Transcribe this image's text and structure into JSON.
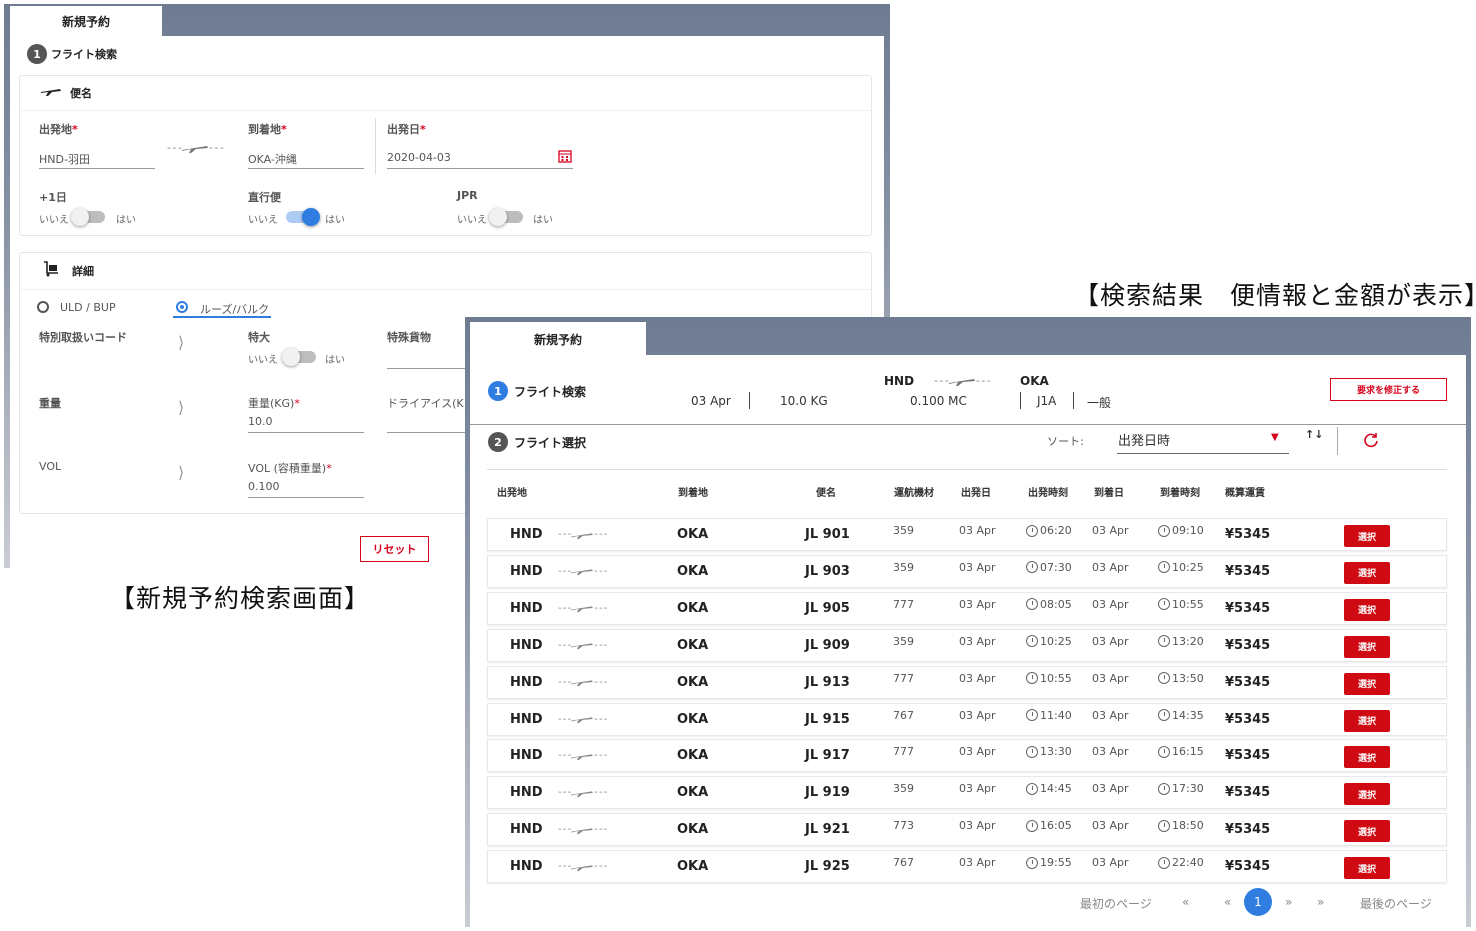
{
  "screen1": {
    "tab_title": "新規予約",
    "step1": {
      "num": "1",
      "label": "フライト検索"
    },
    "flight_section": {
      "title": "便名",
      "origin_label": "出発地",
      "origin_value": "HND-羽田",
      "dest_label": "到着地",
      "dest_value": "OKA-沖縄",
      "date_label": "出発日",
      "date_value": "2020-04-03",
      "plus1_label": "+1日",
      "direct_label": "直行便",
      "jpr_label": "JPR",
      "no": "いいえ",
      "yes": "はい",
      "plus1_on": false,
      "direct_on": true,
      "jpr_on": false
    },
    "detail_section": {
      "title": "詳細",
      "radio_uld": "ULD / BUP",
      "radio_loose": "ルーズ/バルク",
      "special_code_label": "特別取扱いコード",
      "oversize_label": "特大",
      "special_cargo_label": "特殊貨物",
      "weight_row_label": "重量",
      "weight_label": "重量(KG)",
      "weight_value": "10.0",
      "dryice_label": "ドライアイス(K",
      "vol_row_label": "VOL",
      "vol_label": "VOL (容積重量)",
      "vol_value": "0.100",
      "no": "いいえ",
      "yes": "はい",
      "oversize_on": false
    },
    "reset_button": "リセット",
    "caption": "【新規予約検索画面】"
  },
  "screen2": {
    "caption": "【検索結果　便情報と金額が表示】",
    "tab_title": "新規予約",
    "step1": {
      "num": "1",
      "label": "フライト検索"
    },
    "summary": {
      "date": "03 Apr",
      "weight": "10.0 KG",
      "origin": "HND",
      "dest": "OKA",
      "volume": "0.100 MC",
      "code": "J1A",
      "type": "一般"
    },
    "modify_button": "要求を修正する",
    "step2": {
      "num": "2",
      "label": "フライト選択"
    },
    "sort_label": "ソート:",
    "sort_value": "出発日時",
    "columns": [
      "出発地",
      "到着地",
      "便名",
      "運航機材",
      "出発日",
      "出発時刻",
      "到着日",
      "到着時刻",
      "概算運賃"
    ],
    "select_label": "選択",
    "rows": [
      {
        "from": "HND",
        "to": "OKA",
        "flight": "JL 901",
        "aircraft": "359",
        "dep_date": "03 Apr",
        "dep_time": "06:20",
        "arr_date": "03 Apr",
        "arr_time": "09:10",
        "fare": "¥5345"
      },
      {
        "from": "HND",
        "to": "OKA",
        "flight": "JL 903",
        "aircraft": "359",
        "dep_date": "03 Apr",
        "dep_time": "07:30",
        "arr_date": "03 Apr",
        "arr_time": "10:25",
        "fare": "¥5345"
      },
      {
        "from": "HND",
        "to": "OKA",
        "flight": "JL 905",
        "aircraft": "777",
        "dep_date": "03 Apr",
        "dep_time": "08:05",
        "arr_date": "03 Apr",
        "arr_time": "10:55",
        "fare": "¥5345"
      },
      {
        "from": "HND",
        "to": "OKA",
        "flight": "JL 909",
        "aircraft": "359",
        "dep_date": "03 Apr",
        "dep_time": "10:25",
        "arr_date": "03 Apr",
        "arr_time": "13:20",
        "fare": "¥5345"
      },
      {
        "from": "HND",
        "to": "OKA",
        "flight": "JL 913",
        "aircraft": "777",
        "dep_date": "03 Apr",
        "dep_time": "10:55",
        "arr_date": "03 Apr",
        "arr_time": "13:50",
        "fare": "¥5345"
      },
      {
        "from": "HND",
        "to": "OKA",
        "flight": "JL 915",
        "aircraft": "767",
        "dep_date": "03 Apr",
        "dep_time": "11:40",
        "arr_date": "03 Apr",
        "arr_time": "14:35",
        "fare": "¥5345"
      },
      {
        "from": "HND",
        "to": "OKA",
        "flight": "JL 917",
        "aircraft": "777",
        "dep_date": "03 Apr",
        "dep_time": "13:30",
        "arr_date": "03 Apr",
        "arr_time": "16:15",
        "fare": "¥5345"
      },
      {
        "from": "HND",
        "to": "OKA",
        "flight": "JL 919",
        "aircraft": "359",
        "dep_date": "03 Apr",
        "dep_time": "14:45",
        "arr_date": "03 Apr",
        "arr_time": "17:30",
        "fare": "¥5345"
      },
      {
        "from": "HND",
        "to": "OKA",
        "flight": "JL 921",
        "aircraft": "773",
        "dep_date": "03 Apr",
        "dep_time": "16:05",
        "arr_date": "03 Apr",
        "arr_time": "18:50",
        "fare": "¥5345"
      },
      {
        "from": "HND",
        "to": "OKA",
        "flight": "JL 925",
        "aircraft": "767",
        "dep_date": "03 Apr",
        "dep_time": "19:55",
        "arr_date": "03 Apr",
        "arr_time": "22:40",
        "fare": "¥5345"
      }
    ],
    "pagination": {
      "first": "最初のページ",
      "prev2": "«",
      "prev": "«",
      "current": "1",
      "next": "»",
      "next2": "»",
      "last": "最後のページ"
    }
  },
  "colors": {
    "accent_blue": "#2f7de1",
    "step_gray": "#555555",
    "select_red": "#d00a12",
    "required_red": "#d6001c"
  }
}
